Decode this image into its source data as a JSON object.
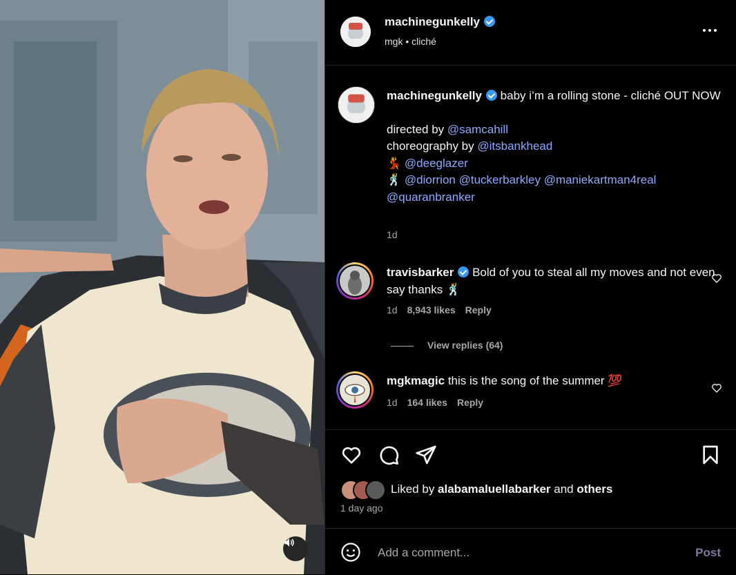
{
  "post": {
    "username": "machinegunkelly",
    "subtitle": "mgk • cliché",
    "caption": {
      "username": "machinegunkelly",
      "line1": "baby i’m a rolling stone - cliché OUT NOW",
      "directed_prefix": "directed by ",
      "directed_by": "@samcahill",
      "choreo_prefix": "choreography by ",
      "choreography_by": "@itsbankhead",
      "dancer_emoji": "💃",
      "dancer": "@deeglazer",
      "man_emoji": "🕺",
      "tags": [
        "@diorrion",
        "@tuckerbarkley",
        "@maniekartman4real",
        "@quaranbranker"
      ],
      "time": "1d"
    }
  },
  "comments": [
    {
      "username": "travisbarker",
      "verified": true,
      "text": "Bold of you to steal all my moves and not even say thanks 🕺",
      "time": "1d",
      "likes": "8,943 likes",
      "reply": "Reply",
      "view_replies": "View replies (64)"
    },
    {
      "username": "mgkmagic",
      "verified": false,
      "text": "this is the song of the summer 💯",
      "time": "1d",
      "likes": "164 likes",
      "reply": "Reply"
    }
  ],
  "likes": {
    "prefix": "Liked by ",
    "user": "alabamaluellabarker",
    "and": " and ",
    "others": "others",
    "ago": "1 day ago"
  },
  "composer": {
    "placeholder": "Add a comment...",
    "post_label": "Post"
  },
  "icons": {
    "like": "heart-icon",
    "comment": "comment-icon",
    "share": "share-icon",
    "save": "bookmark-icon",
    "emoji": "emoji-icon",
    "sound": "speaker-icon",
    "more": "more-icon"
  },
  "colors": {
    "link": "#8ea9ff",
    "verified": "#3897f0",
    "muted": "#a8a8a8"
  }
}
